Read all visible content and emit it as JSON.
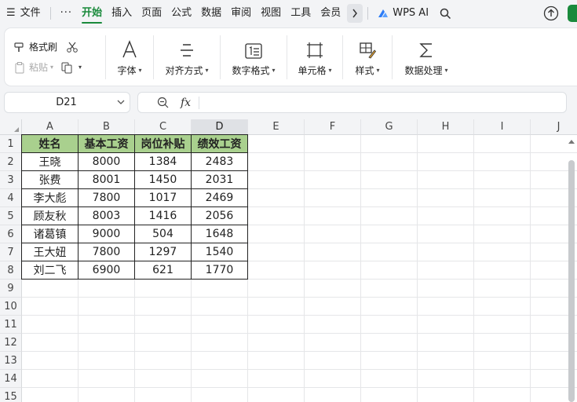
{
  "menu": {
    "file": "文件",
    "more": "···",
    "tabs": [
      "开始",
      "插入",
      "页面",
      "公式",
      "数据",
      "审阅",
      "视图",
      "工具",
      "会员"
    ],
    "active_tab": "开始",
    "wps_ai": "WPS AI"
  },
  "ribbon": {
    "format_painter": "格式刷",
    "paste": "粘贴",
    "font": "字体",
    "align": "对齐方式",
    "number_format": "数字格式",
    "cell": "单元格",
    "style": "样式",
    "data_process": "数据处理"
  },
  "formula_bar": {
    "name_box": "D21",
    "fx": "fx",
    "content": ""
  },
  "grid": {
    "columns": [
      "A",
      "B",
      "C",
      "D",
      "E",
      "F",
      "G",
      "H",
      "I",
      "J"
    ],
    "selected_column": "D",
    "rows": [
      "1",
      "2",
      "3",
      "4",
      "5",
      "6",
      "7",
      "8",
      "9",
      "10",
      "11",
      "12",
      "13",
      "14",
      "15"
    ]
  },
  "table": {
    "headers": [
      "姓名",
      "基本工资",
      "岗位补贴",
      "绩效工资"
    ],
    "rows": [
      [
        "王晓",
        "8000",
        "1384",
        "2483"
      ],
      [
        "张费",
        "8001",
        "1450",
        "2031"
      ],
      [
        "李大彪",
        "7800",
        "1017",
        "2469"
      ],
      [
        "顾友秋",
        "8003",
        "1416",
        "2056"
      ],
      [
        "诸葛镇",
        "9000",
        "504",
        "1648"
      ],
      [
        "王大妞",
        "7800",
        "1297",
        "1540"
      ],
      [
        "刘二飞",
        "6900",
        "621",
        "1770"
      ]
    ]
  },
  "colors": {
    "accent": "#1a8a3c",
    "header_fill": "#a9d08e"
  }
}
